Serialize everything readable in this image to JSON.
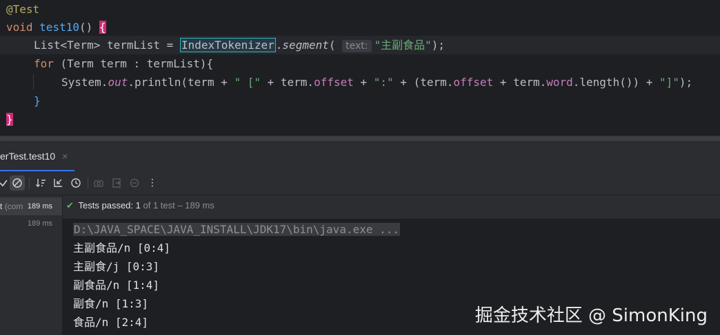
{
  "editor": {
    "annotation": "@Test",
    "kw_void": "void",
    "method_name": "test10",
    "paren": "()",
    "open_brace": "{",
    "line3": {
      "type": "List<Term> termList = ",
      "selected_class": "IndexTokenizer",
      "dot": ".",
      "method": "segment",
      "open": "(",
      "param_hint": "text:",
      "string": "\"主副食品\"",
      "close": ");"
    },
    "line4": {
      "kw_for": "for",
      "rest": " (Term term : termList){"
    },
    "line5": {
      "p1": "System.",
      "out": "out",
      "p2": ".println(term + ",
      "s1": "\" [\"",
      "p3": " + term.",
      "f1": "offset",
      "p4": " + ",
      "s2": "\":\"",
      "p5": " + (term.",
      "f2": "offset",
      "p6": " + term.",
      "f3": "word",
      "p7": ".length()) + ",
      "s3": "\"]\"",
      "p8": ");"
    },
    "inner_close": "}",
    "outer_close": "}"
  },
  "run_tab": {
    "label": "erTest.test10",
    "close": "×"
  },
  "toolbar": {
    "icons": [
      "check-icon",
      "stop-circle-icon",
      "sort-icon",
      "collapse-icon",
      "clock-icon",
      "camera-icon",
      "export-icon",
      "import-icon",
      "more-icon"
    ],
    "more": "⋮"
  },
  "tree": {
    "row1_label": "t",
    "row1_suffix": "(com",
    "row1_time": "189 ms",
    "row2_time": "189 ms"
  },
  "status": {
    "passed_label": "Tests passed:",
    "passed_count": "1",
    "of_text": "of 1 test – 189 ms"
  },
  "console": {
    "command": "D:\\JAVA_SPACE\\JAVA_INSTALL\\JDK17\\bin\\java.exe ...",
    "lines": [
      "主副食品/n [0:4]",
      "主副食/j [0:3]",
      "副食品/n [1:4]",
      "副食/n [1:3]",
      "食品/n [2:4]"
    ]
  },
  "watermark": "掘金技术社区 @ SimonKing",
  "colors": {
    "editor_bg": "#1e1f22",
    "keyword": "#cf8e6d",
    "method": "#56a8f5",
    "string": "#6aab73",
    "field": "#c77dbb",
    "brace_highlight": "#d22a77",
    "pass_green": "#5fb865"
  }
}
